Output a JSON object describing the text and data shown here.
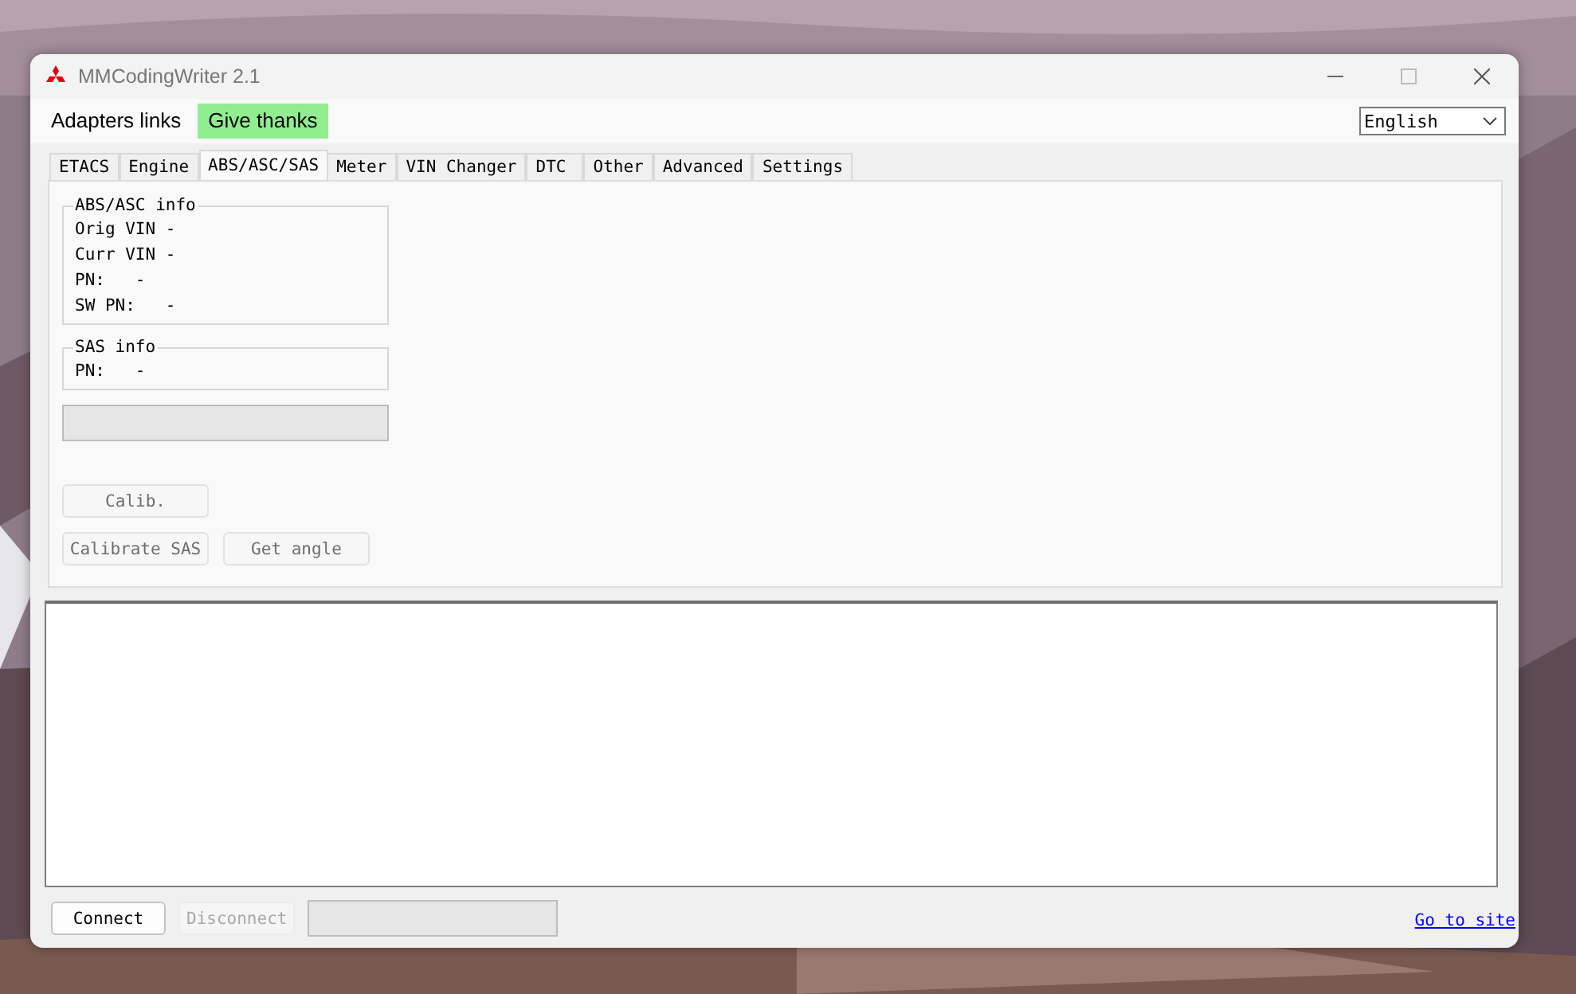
{
  "window": {
    "title": "MMCodingWriter 2.1"
  },
  "menu": [
    {
      "label": "Adapters links",
      "highlighted": false
    },
    {
      "label": "Give thanks",
      "highlighted": true
    }
  ],
  "language_select": {
    "value": "English"
  },
  "tabs": [
    {
      "label": "ETACS",
      "selected": false
    },
    {
      "label": "Engine",
      "selected": false
    },
    {
      "label": "ABS/ASC/SAS",
      "selected": true
    },
    {
      "label": "Meter",
      "selected": false
    },
    {
      "label": "VIN Changer",
      "selected": false
    },
    {
      "label": "DTC",
      "selected": false
    },
    {
      "label": "Other",
      "selected": false
    },
    {
      "label": "Advanced",
      "selected": false
    },
    {
      "label": "Settings",
      "selected": false
    }
  ],
  "groups": [
    {
      "title": "ABS/ASC info",
      "rows": [
        "Orig VIN -",
        "Curr VIN -",
        "PN:   -",
        "SW PN:   -"
      ]
    },
    {
      "title": "SAS info",
      "rows": [
        "PN:   -"
      ]
    }
  ],
  "progress": {
    "level": 0
  },
  "actions": [
    [
      {
        "label": "Calib.",
        "disabled": true
      }
    ],
    [
      {
        "label": "Calibrate SAS",
        "disabled": true
      },
      {
        "label": "Get angle",
        "disabled": true
      }
    ]
  ],
  "bottom_bar": {
    "buttons": [
      {
        "label": "Connect",
        "disabled": false
      },
      {
        "label": "Disconnect",
        "disabled": true
      }
    ],
    "link": "Go to site"
  }
}
